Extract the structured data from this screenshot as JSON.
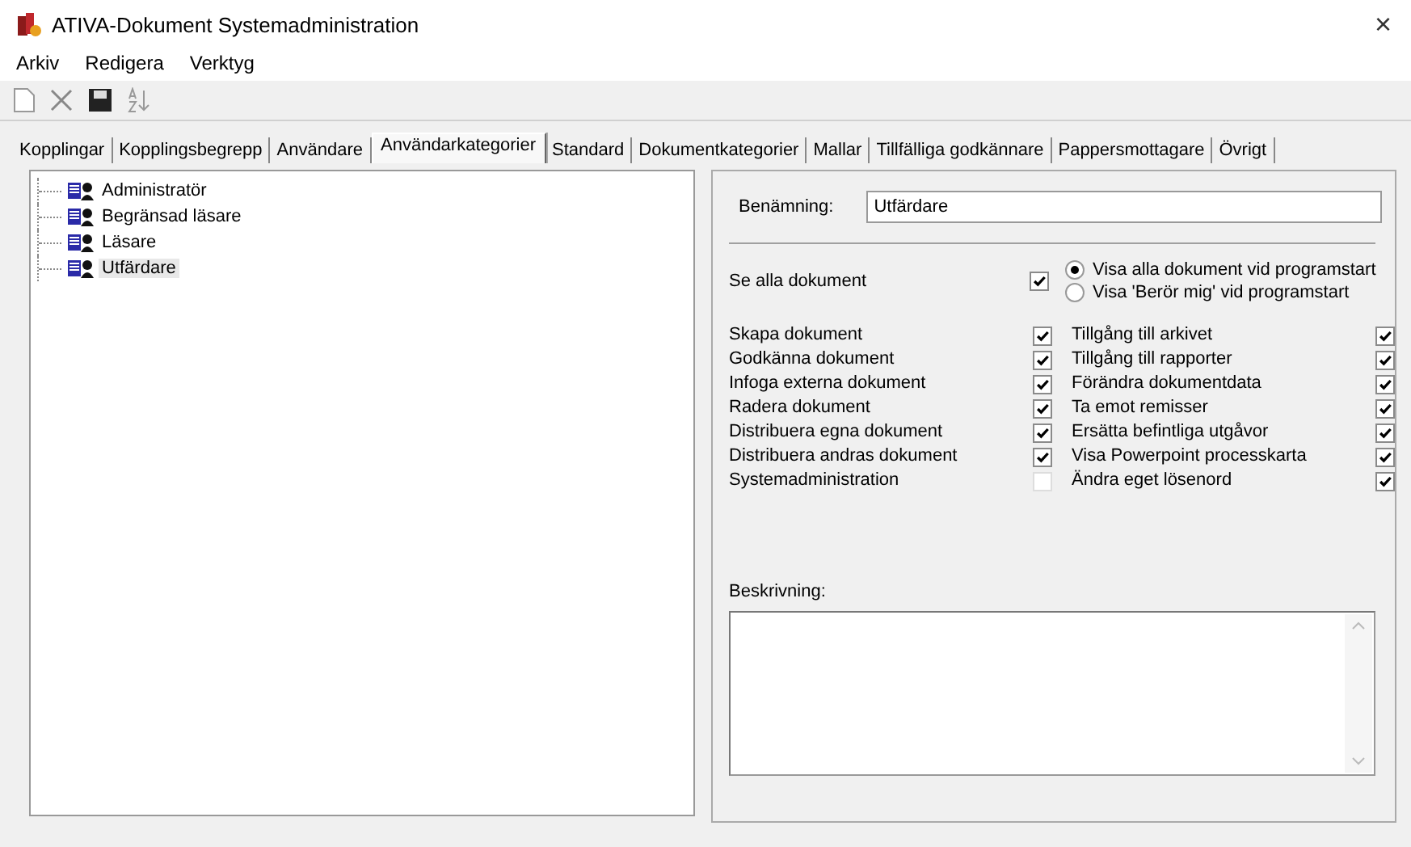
{
  "window": {
    "title": "ATIVA-Dokument Systemadministration",
    "close": "×"
  },
  "menu": [
    "Arkiv",
    "Redigera",
    "Verktyg"
  ],
  "tabs": [
    {
      "label": "Kopplingar",
      "selected": false
    },
    {
      "label": "Kopplingsbegrepp",
      "selected": false
    },
    {
      "label": "Användare",
      "selected": false
    },
    {
      "label": "Användarkategorier",
      "selected": true
    },
    {
      "label": "Standard",
      "selected": false
    },
    {
      "label": "Dokumentkategorier",
      "selected": false
    },
    {
      "label": "Mallar",
      "selected": false
    },
    {
      "label": "Tillfälliga godkännare",
      "selected": false
    },
    {
      "label": "Pappersmottagare",
      "selected": false
    },
    {
      "label": "Övrigt",
      "selected": false
    }
  ],
  "tree": [
    {
      "label": "Administratör",
      "selected": false
    },
    {
      "label": "Begränsad läsare",
      "selected": false
    },
    {
      "label": "Läsare",
      "selected": false
    },
    {
      "label": "Utfärdare",
      "selected": true
    }
  ],
  "form": {
    "name_label": "Benämning:",
    "name_value": "Utfärdare",
    "see_all": {
      "label": "Se alla dokument",
      "checked": true
    },
    "start_options": [
      {
        "label": "Visa alla dokument vid programstart",
        "selected": true
      },
      {
        "label": "Visa 'Berör mig' vid programstart",
        "selected": false
      }
    ],
    "permissions_left": [
      {
        "label": "Skapa dokument",
        "checked": true
      },
      {
        "label": "Godkänna dokument",
        "checked": true
      },
      {
        "label": "Infoga externa dokument",
        "checked": true
      },
      {
        "label": "Radera dokument",
        "checked": true
      },
      {
        "label": "Distribuera egna dokument",
        "checked": true
      },
      {
        "label": "Distribuera andras dokument",
        "checked": true
      },
      {
        "label": "Systemadministration",
        "checked": false
      }
    ],
    "permissions_right": [
      {
        "label": "Tillgång till arkivet",
        "checked": true
      },
      {
        "label": "Tillgång till rapporter",
        "checked": true
      },
      {
        "label": "Förändra dokumentdata",
        "checked": true
      },
      {
        "label": "Ta emot remisser",
        "checked": true
      },
      {
        "label": "Ersätta befintliga utgåvor",
        "checked": true
      },
      {
        "label": "Visa Powerpoint processkarta",
        "checked": true
      },
      {
        "label": "Ändra eget lösenord",
        "checked": true
      }
    ],
    "description_label": "Beskrivning:"
  }
}
